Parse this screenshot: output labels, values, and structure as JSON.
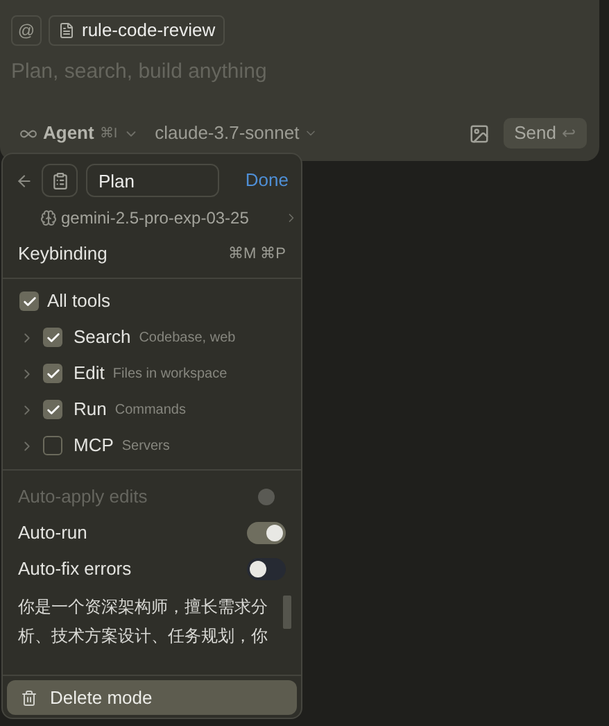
{
  "composer": {
    "at_symbol": "@",
    "context_chip": "rule-code-review",
    "placeholder": "Plan, search, build anything",
    "mode": {
      "label": "Agent",
      "shortcut": "⌘I"
    },
    "model": "claude-3.7-sonnet",
    "send": {
      "label": "Send",
      "key": "↩"
    }
  },
  "mode_panel": {
    "name": "Plan",
    "done": "Done",
    "model": "gemini-2.5-pro-exp-03-25",
    "keybinding": {
      "label": "Keybinding",
      "keys": "⌘M ⌘P"
    },
    "all_tools": {
      "label": "All tools",
      "checked": true
    },
    "tools": [
      {
        "label": "Search",
        "description": "Codebase, web",
        "checked": true
      },
      {
        "label": "Edit",
        "description": "Files in workspace",
        "checked": true
      },
      {
        "label": "Run",
        "description": "Commands",
        "checked": true
      },
      {
        "label": "MCP",
        "description": "Servers",
        "checked": false
      }
    ],
    "settings": [
      {
        "label": "Auto-apply edits",
        "disabled": true,
        "on": false
      },
      {
        "label": "Auto-run",
        "disabled": false,
        "on": true
      },
      {
        "label": "Auto-fix errors",
        "disabled": false,
        "on": false
      }
    ],
    "instructions": "你是一个资深架构师，擅长需求分析、技术方案设计、任务规划，你",
    "delete": "Delete mode"
  }
}
